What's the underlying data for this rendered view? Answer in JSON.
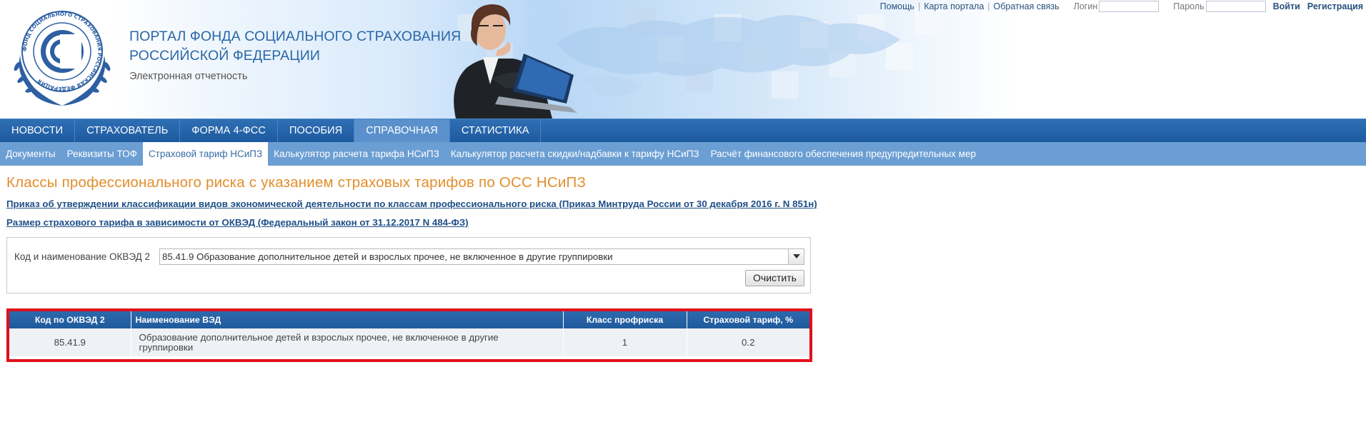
{
  "header": {
    "title_line1": "ПОРТАЛ ФОНДА СОЦИАЛЬНОГО СТРАХОВАНИЯ",
    "title_line2": "РОССИЙСКОЙ ФЕДЕРАЦИИ",
    "subtitle": "Электронная отчетность",
    "logo_ring_text": "ФОНД СОЦИАЛЬНОГО СТРАХОВАНИЯ РОССИЙСКАЯ ФЕДЕРАЦИЯ"
  },
  "toplinks": {
    "help": "Помощь",
    "sitemap": "Карта портала",
    "feedback": "Обратная связь",
    "login_label": "Логин",
    "login_value": "",
    "password_label": "Пароль",
    "password_value": "",
    "signin": "Войти",
    "register": "Регистрация"
  },
  "mainnav": {
    "items": [
      "НОВОСТИ",
      "СТРАХОВАТЕЛЬ",
      "ФОРМА 4-ФСС",
      "ПОСОБИЯ",
      "СПРАВОЧНАЯ",
      "СТАТИСТИКА"
    ],
    "active": "СПРАВОЧНАЯ"
  },
  "subnav": {
    "items": [
      "Документы",
      "Реквизиты ТОФ",
      "Страховой тариф НСиПЗ",
      "Калькулятор расчета тарифа НСиПЗ",
      "Калькулятор расчета скидки/надбавки к тарифу НСиПЗ",
      "Расчёт финансового обеспечения предупредительных мер"
    ],
    "active": "Страховой тариф НСиПЗ"
  },
  "main": {
    "page_title": "Классы профессионального риска с указанием страховых тарифов по ОСС НСиПЗ",
    "link1": "Приказ об утверждении классификации видов экономической деятельности по классам профессионального риска (Приказ Минтруда России от 30 декабря 2016 г. N 851н)",
    "link2": "Размер страхового тарифа в зависимости от ОКВЭД (Федеральный закон от 31.12.2017 N 484-ФЗ)"
  },
  "filter": {
    "label": "Код и наименование ОКВЭД 2",
    "selected": "85.41.9 Образование дополнительное детей и взрослых прочее, не включенное в другие группировки",
    "clear_button": "Очистить"
  },
  "result_table": {
    "headers": [
      "Код по ОКВЭД 2",
      "Наименование ВЭД",
      "Класс профриска",
      "Страховой тариф, %"
    ],
    "rows": [
      {
        "code": "85.41.9",
        "name": "Образование дополнительное детей и взрослых прочее, не включенное в другие группировки",
        "risk_class": "1",
        "rate": "0.2"
      }
    ]
  },
  "colors": {
    "nav_blue": "#1d5aa0",
    "subnav_blue": "#6b9ed3",
    "title_orange": "#e38d2c",
    "highlight_red": "#e0101b"
  }
}
